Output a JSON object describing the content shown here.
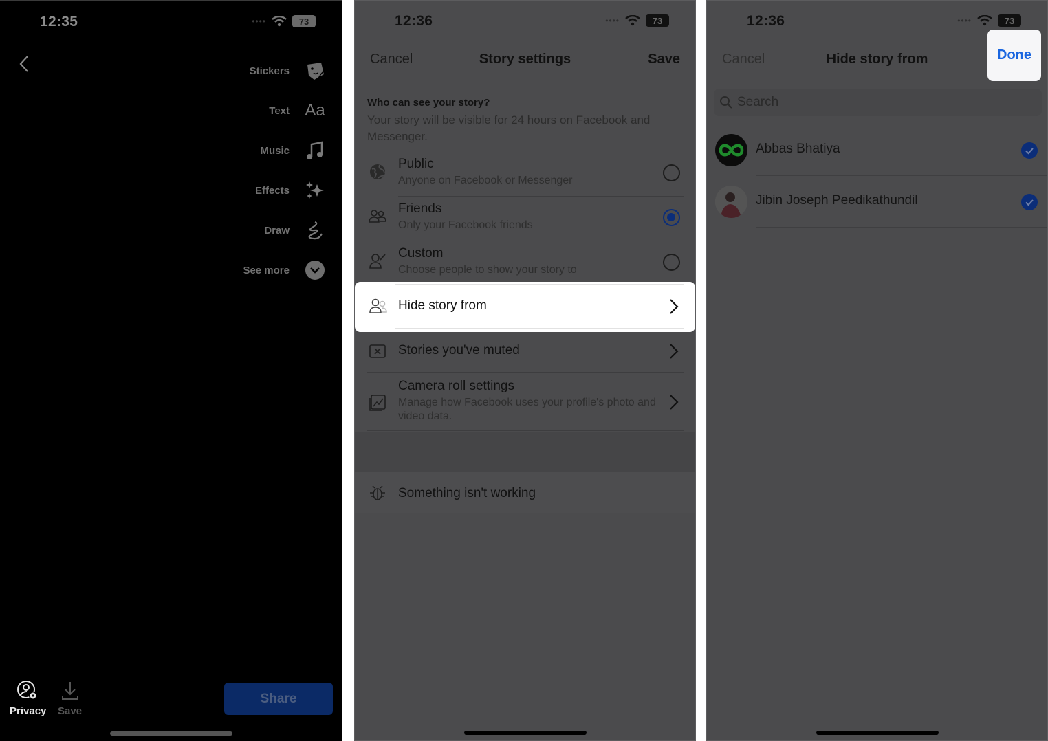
{
  "panel1": {
    "status": {
      "time": "12:35",
      "battery": "73"
    },
    "tools": [
      {
        "label": "Stickers",
        "icon": "sticker-icon"
      },
      {
        "label": "Text",
        "icon": "text-aa-icon"
      },
      {
        "label": "Music",
        "icon": "music-note-icon"
      },
      {
        "label": "Effects",
        "icon": "sparkles-icon"
      },
      {
        "label": "Draw",
        "icon": "scribble-icon"
      },
      {
        "label": "See more",
        "icon": "chevron-down-circle-icon"
      }
    ],
    "bottom": {
      "privacy_label": "Privacy",
      "save_label": "Save",
      "share_label": "Share"
    }
  },
  "panel2": {
    "status": {
      "time": "12:36",
      "battery": "73"
    },
    "nav": {
      "cancel": "Cancel",
      "title": "Story settings",
      "save": "Save"
    },
    "section_heading": "Who can see your story?",
    "section_sub": "Your story will be visible for 24 hours on Facebook and Messenger.",
    "audience_options": [
      {
        "title": "Public",
        "subtitle": "Anyone on Facebook or Messenger",
        "selected": false
      },
      {
        "title": "Friends",
        "subtitle": "Only your Facebook friends",
        "selected": true
      },
      {
        "title": "Custom",
        "subtitle": "Choose people to show your story to",
        "selected": false
      }
    ],
    "hide_story_from": "Hide story from",
    "stories_muted": "Stories you've muted",
    "camera_roll": {
      "title": "Camera roll settings",
      "subtitle": "Manage how Facebook uses your profile's photo and video data."
    },
    "something_wrong": "Something isn't working"
  },
  "panel3": {
    "status": {
      "time": "12:36",
      "battery": "73"
    },
    "nav": {
      "cancel": "Cancel",
      "title": "Hide story from",
      "done": "Done"
    },
    "search_placeholder": "Search",
    "people": [
      {
        "name": "Abbas Bhatiya",
        "checked": true
      },
      {
        "name": "Jibin Joseph Peedikathundil",
        "checked": true
      }
    ],
    "colors": {
      "accent": "#1a66e0",
      "check_fill": "#0b2d79",
      "share_button": "#0b2a66"
    }
  }
}
